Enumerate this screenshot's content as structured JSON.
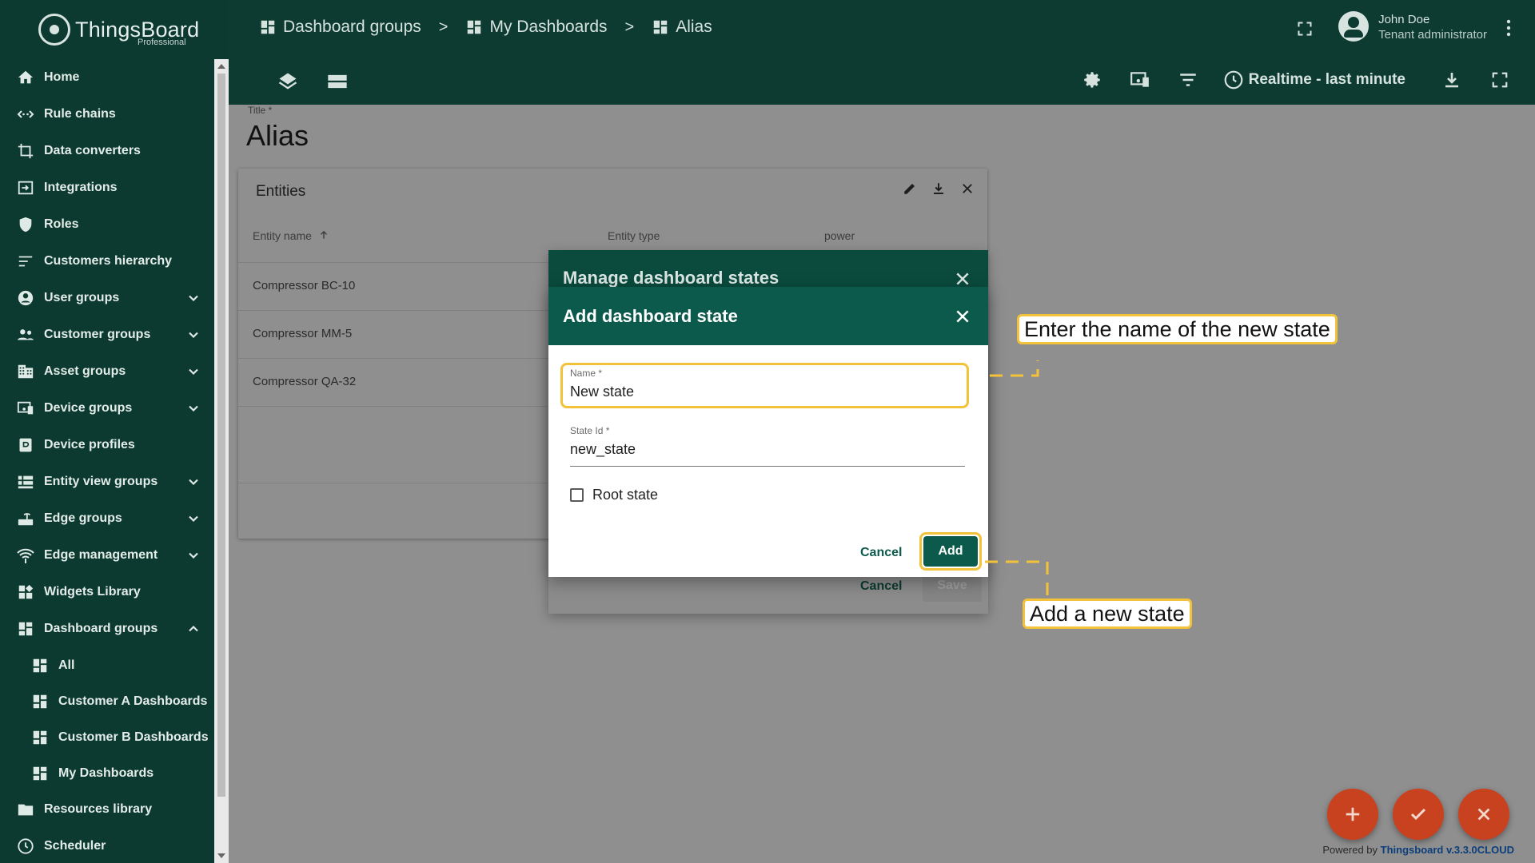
{
  "app": {
    "brand": "ThingsBoard",
    "edition": "Professional"
  },
  "sidebar": {
    "items": [
      {
        "label": "Home",
        "icon": "home-icon"
      },
      {
        "label": "Rule chains",
        "icon": "rule-chains-icon"
      },
      {
        "label": "Data converters",
        "icon": "data-converters-icon"
      },
      {
        "label": "Integrations",
        "icon": "integrations-icon"
      },
      {
        "label": "Roles",
        "icon": "shield-icon"
      },
      {
        "label": "Customers hierarchy",
        "icon": "hierarchy-icon"
      },
      {
        "label": "User groups",
        "icon": "user-icon"
      },
      {
        "label": "Customer groups",
        "icon": "people-icon"
      },
      {
        "label": "Asset groups",
        "icon": "building-icon"
      },
      {
        "label": "Device groups",
        "icon": "devices-icon"
      },
      {
        "label": "Device profiles",
        "icon": "device-profile-icon"
      },
      {
        "label": "Entity view groups",
        "icon": "entity-view-icon"
      },
      {
        "label": "Edge groups",
        "icon": "router-icon"
      },
      {
        "label": "Edge management",
        "icon": "wifi-icon"
      },
      {
        "label": "Widgets Library",
        "icon": "widgets-icon"
      },
      {
        "label": "Dashboard groups",
        "icon": "dashboard-icon"
      },
      {
        "label": "All",
        "icon": "dashboard-icon"
      },
      {
        "label": "Customer A Dashboards",
        "icon": "dashboard-icon"
      },
      {
        "label": "Customer B Dashboards",
        "icon": "dashboard-icon"
      },
      {
        "label": "My Dashboards",
        "icon": "dashboard-icon"
      },
      {
        "label": "Resources library",
        "icon": "folder-icon"
      },
      {
        "label": "Scheduler",
        "icon": "clock-icon"
      }
    ]
  },
  "header": {
    "breadcrumb": [
      "Dashboard groups",
      "My Dashboards",
      "Alias"
    ],
    "separator": ">",
    "user_name": "John Doe",
    "user_role": "Tenant administrator",
    "time_window": "Realtime - last minute"
  },
  "main": {
    "title_label": "Title *",
    "title": "Alias",
    "widget": {
      "title": "Entities",
      "columns": [
        "Entity name",
        "Entity type",
        "power"
      ],
      "rows": [
        "Compressor BC-10",
        "Compressor MM-5",
        "Compressor QA-32"
      ]
    }
  },
  "manage_dialog": {
    "title": "Manage dashboard states",
    "cancel": "Cancel",
    "save": "Save"
  },
  "add_dialog": {
    "title": "Add dashboard state",
    "name_label": "Name *",
    "name_value": "New state",
    "state_id_label": "State Id *",
    "state_id_value": "new_state",
    "root_state_label": "Root state",
    "root_state_checked": false,
    "cancel": "Cancel",
    "add": "Add"
  },
  "callouts": {
    "name_hint": "Enter the name of the new state",
    "add_hint": "Add a new state"
  },
  "footer": {
    "powered_prefix": "Powered by",
    "powered_link": "Thingsboard v.3.3.0CLOUD"
  },
  "colors": {
    "primary": "#0b5a4b",
    "sidebar": "#0c3a30",
    "accent": "#c9421f",
    "highlight": "#f3c23b"
  }
}
